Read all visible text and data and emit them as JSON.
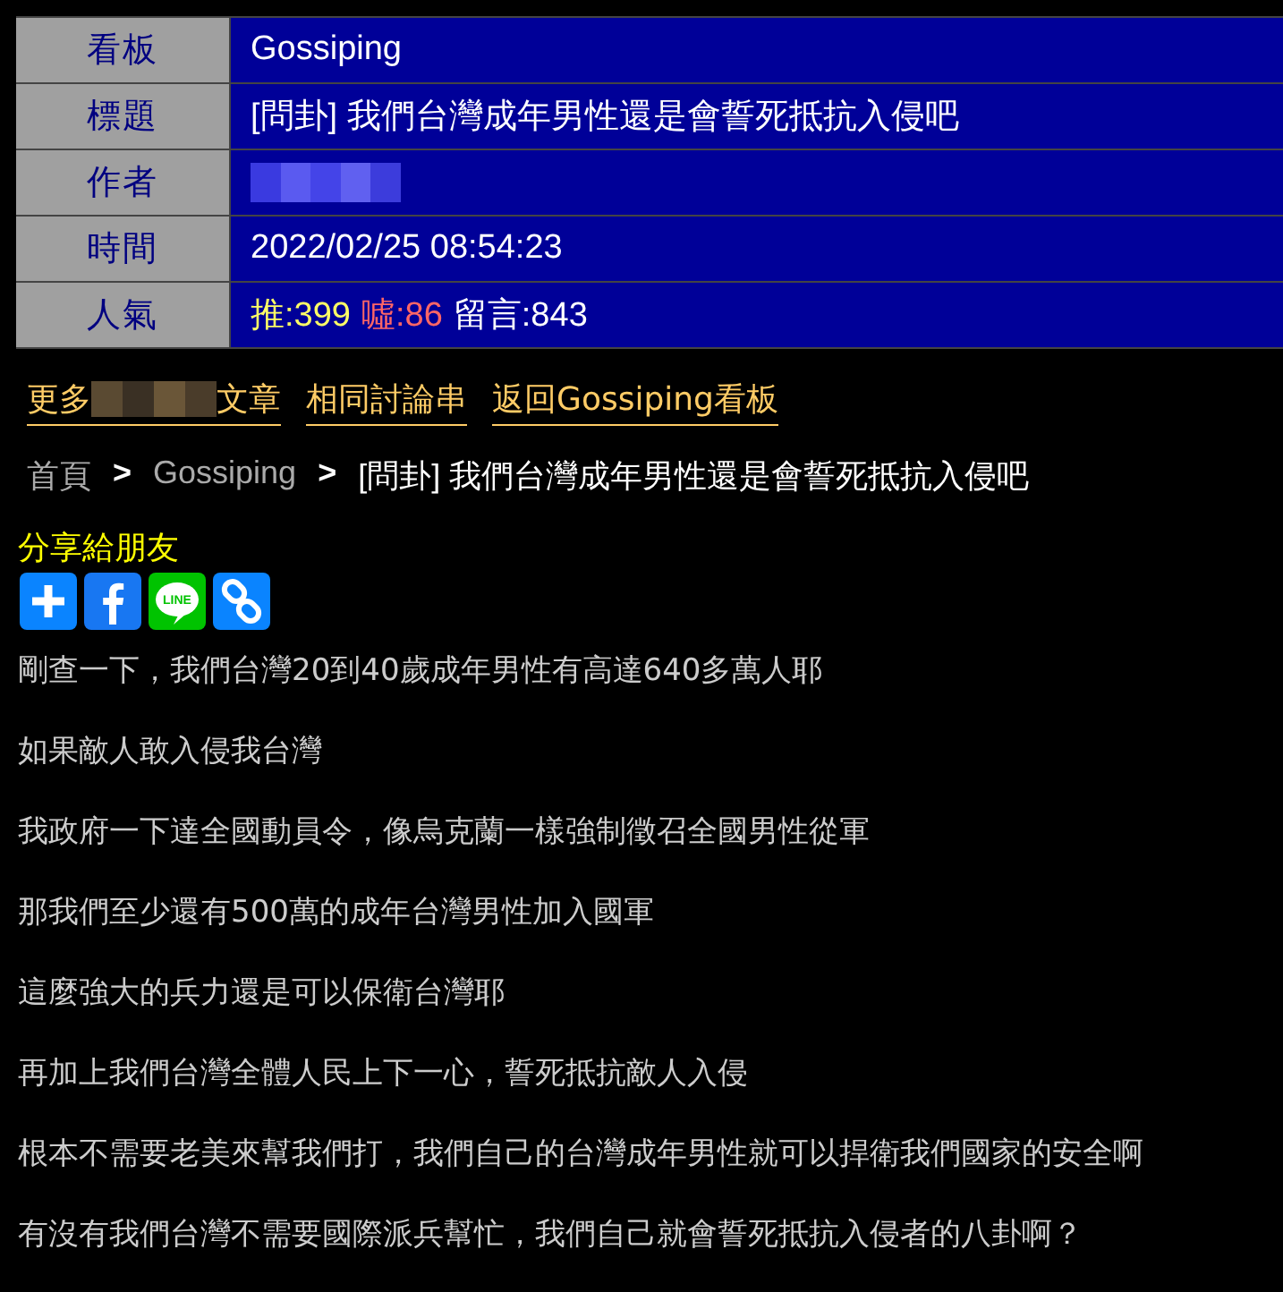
{
  "meta": [
    {
      "label": "看板",
      "value": "Gossiping"
    },
    {
      "label": "標題",
      "value": "[問卦] 我們台灣成年男性還是會誓死抵抗入侵吧"
    },
    {
      "label": "作者",
      "kind": "redacted"
    },
    {
      "label": "時間",
      "value": "2022/02/25 08:54:23"
    },
    {
      "label": "人氣",
      "kind": "stats",
      "stats": [
        {
          "text": "推:399",
          "kind": "push"
        },
        {
          "text": "噓:86",
          "kind": "boo"
        },
        {
          "text": "留言:843",
          "kind": "plain"
        }
      ]
    }
  ],
  "links": [
    {
      "before": "更多",
      "redacted": true,
      "after": "文章"
    },
    {
      "before": "相同討論串",
      "redacted": false
    },
    {
      "before": "返回Gossiping看板",
      "redacted": false
    }
  ],
  "breadcrumb": [
    {
      "text": "首頁",
      "kind": "link"
    },
    {
      "text": ">",
      "kind": "sep"
    },
    {
      "text": "Gossiping",
      "kind": "link"
    },
    {
      "text": ">",
      "kind": "sep"
    },
    {
      "text": "[問卦] 我們台灣成年男性還是會誓死抵抗入侵吧",
      "kind": "current"
    }
  ],
  "share": {
    "title": "分享給朋友",
    "buttons": [
      {
        "kind": "add"
      },
      {
        "kind": "facebook"
      },
      {
        "kind": "line",
        "label": "LINE"
      },
      {
        "kind": "link"
      }
    ]
  },
  "paragraphs": [
    "剛查一下，我們台灣20到40歲成年男性有高達640多萬人耶",
    "如果敵人敢入侵我台灣",
    "我政府一下達全國動員令，像烏克蘭一樣強制徵召全國男性從軍",
    "那我們至少還有500萬的成年台灣男性加入國軍",
    "這麼強大的兵力還是可以保衛台灣耶",
    "再加上我們台灣全體人民上下一心，誓死抵抗敵人入侵",
    "根本不需要老美來幫我們打，我們自己的台灣成年男性就可以捍衛我們國家的安全啊",
    "有沒有我們台灣不需要國際派兵幫忙，我們自己就會誓死抵抗入侵者的八卦啊？"
  ]
}
